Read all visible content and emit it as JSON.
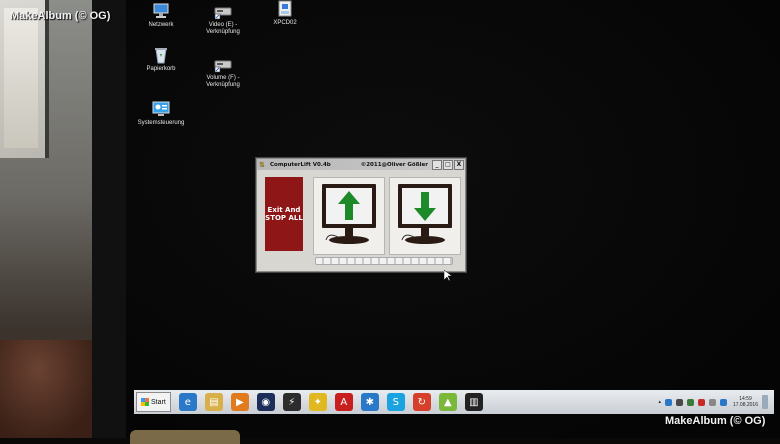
{
  "watermarks": {
    "top_left": "MakeAlbum (© OG)",
    "bottom_right": "MakeAlbum (© OG)"
  },
  "desktop_icons": [
    {
      "label": "Netzwerk",
      "icon": "network-icon"
    },
    {
      "label": "Video (E) - Verknüpfung",
      "icon": "drive-shortcut-icon"
    },
    {
      "label": "XPCD02",
      "icon": "executable-icon"
    },
    {
      "label": "Papierkorb",
      "icon": "recycle-bin-icon"
    },
    {
      "label": "Volume (F) - Verknüpfung",
      "icon": "drive-shortcut-icon"
    },
    {
      "label": "Systemsteuerung",
      "icon": "control-panel-icon"
    }
  ],
  "app": {
    "title": "ComputerLift V0.4b",
    "copyright": "©2011@Oliver Gößler",
    "exit_label": "Exit And STOP ALL",
    "window_buttons": [
      "_",
      "□",
      "X"
    ],
    "upload_icon": "monitor-up-arrow-icon",
    "download_icon": "monitor-down-arrow-icon"
  },
  "taskbar": {
    "start_label": "Start",
    "apps": [
      {
        "icon": "ie-icon",
        "color": "#2a78c8",
        "glyph": "e"
      },
      {
        "icon": "explorer-icon",
        "color": "#d8b04a",
        "glyph": "▤"
      },
      {
        "icon": "media-player-icon",
        "color": "#e07b1e",
        "glyph": "▶"
      },
      {
        "icon": "eye-icon",
        "color": "#1e2e5a",
        "glyph": "◉"
      },
      {
        "icon": "power-icon",
        "color": "#2c2c2c",
        "glyph": "⚡"
      },
      {
        "icon": "puzzle-icon",
        "color": "#e0b820",
        "glyph": "✦"
      },
      {
        "icon": "avira-icon",
        "color": "#c81e1e",
        "glyph": "A"
      },
      {
        "icon": "network-app-icon",
        "color": "#2a78c8",
        "glyph": "✱"
      },
      {
        "icon": "skype-icon",
        "color": "#1aa3e0",
        "glyph": "S"
      },
      {
        "icon": "sync-icon",
        "color": "#d6402a",
        "glyph": "↻"
      },
      {
        "icon": "android-icon",
        "color": "#7ab83a",
        "glyph": "▲"
      },
      {
        "icon": "equalizer-icon",
        "color": "#222222",
        "glyph": "▥"
      }
    ],
    "tray_colors": [
      "#2a78c8",
      "#4a4a4a",
      "#3a7a3a",
      "#c82a2a",
      "#888888",
      "#2a78c8"
    ],
    "clock_time": "14:59",
    "clock_date": "17.08.2016"
  }
}
